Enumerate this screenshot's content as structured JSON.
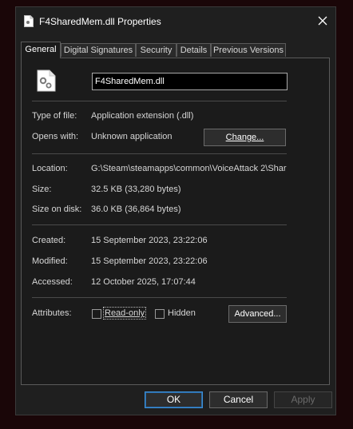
{
  "window": {
    "title": "F4SharedMem.dll Properties"
  },
  "tabs": [
    {
      "label": "General"
    },
    {
      "label": "Digital Signatures"
    },
    {
      "label": "Security"
    },
    {
      "label": "Details"
    },
    {
      "label": "Previous Versions"
    }
  ],
  "general": {
    "file_name": "F4SharedMem.dll",
    "type_label": "Type of file:",
    "type_value": "Application extension (.dll)",
    "opens_label": "Opens with:",
    "opens_value": "Unknown application",
    "change_label": "Change...",
    "location_label": "Location:",
    "location_value": "G:\\Steam\\steamapps\\common\\VoiceAttack 2\\Shar",
    "size_label": "Size:",
    "size_value": "32.5 KB (33,280 bytes)",
    "size_on_disk_label": "Size on disk:",
    "size_on_disk_value": "36.0 KB (36,864 bytes)",
    "created_label": "Created:",
    "created_value": "15 September 2023, 23:22:06",
    "modified_label": "Modified:",
    "modified_value": "15 September 2023, 23:22:06",
    "accessed_label": "Accessed:",
    "accessed_value": "12 October 2025, 17:07:44",
    "attributes_label": "Attributes:",
    "readonly_label": "Read-only",
    "hidden_label": "Hidden",
    "advanced_label": "Advanced..."
  },
  "footer": {
    "ok": "OK",
    "cancel": "Cancel",
    "apply": "Apply"
  }
}
